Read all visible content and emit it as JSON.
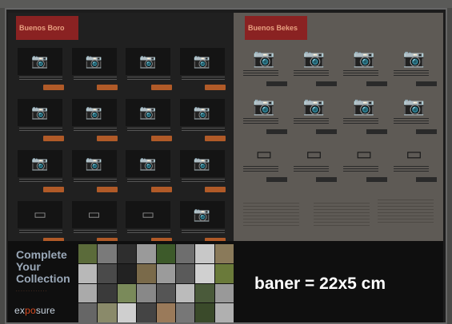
{
  "left_poster": {
    "brand": "Buenos Boro",
    "cameras": [
      "📷",
      "📷",
      "📷",
      "📷",
      "📷",
      "📷",
      "📷",
      "📷",
      "📷",
      "📷",
      "📷",
      "📷",
      "▭",
      "▭",
      "▭",
      "📷"
    ]
  },
  "right_poster": {
    "brand": "Buenos Bekes",
    "cameras": [
      "📷",
      "📷",
      "📷",
      "📷",
      "📷",
      "📷",
      "📷",
      "📷",
      "▭",
      "▭",
      "▭",
      "▭"
    ]
  },
  "promo": {
    "line1": "Complete",
    "line2": "Your",
    "line3": "Collection",
    "sub": "· · · · · · · · · · · · ·",
    "logo_prefix": "ex",
    "logo_accent": "po",
    "logo_suffix": "sure"
  },
  "mosaic_colors": [
    "#5b6b3a",
    "#7a7a7a",
    "#2e2e2e",
    "#9a9a9a",
    "#3d5a2a",
    "#6e6e6e",
    "#c8c8c8",
    "#8a7a5a",
    "#b8b8b8",
    "#4a4a4a",
    "#222",
    "#7a6a4a",
    "#9b9b9b",
    "#5a5a5a",
    "#d0d0d0",
    "#6a7a3a",
    "#aaaaaa",
    "#3a3a3a",
    "#7a8a5a",
    "#888",
    "#555",
    "#bbbbbb",
    "#4a5a3a",
    "#999",
    "#666",
    "#8a8a6a",
    "#cfcfcf",
    "#444",
    "#9a7a5a",
    "#777",
    "#3a4a2a",
    "#b0b0b0"
  ],
  "caption": "baner = 22x5 cm"
}
